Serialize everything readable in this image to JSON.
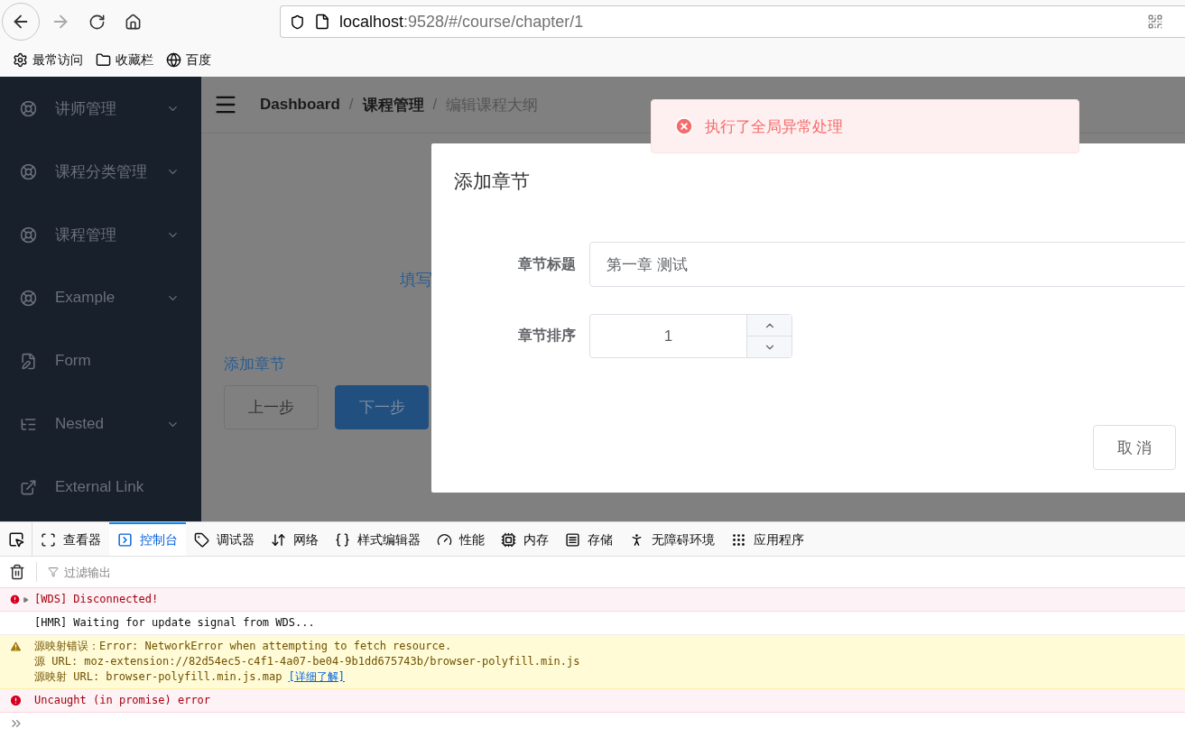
{
  "browser": {
    "address": {
      "host": "localhost",
      "path": ":9528/#/course/chapter/1"
    },
    "bookmarks": [
      {
        "label": "最常访问"
      },
      {
        "label": "收藏栏"
      },
      {
        "label": "百度"
      }
    ]
  },
  "sidebar": {
    "items": [
      {
        "label": "讲师管理",
        "expandable": true
      },
      {
        "label": "课程分类管理",
        "expandable": true
      },
      {
        "label": "课程管理",
        "expandable": true
      },
      {
        "label": "Example",
        "expandable": true
      },
      {
        "label": "Form",
        "expandable": false
      },
      {
        "label": "Nested",
        "expandable": true
      },
      {
        "label": "External Link",
        "expandable": false
      }
    ]
  },
  "breadcrumb": {
    "separator": "/",
    "items": [
      {
        "label": "Dashboard",
        "current": false
      },
      {
        "label": "课程管理",
        "current": false
      },
      {
        "label": "编辑课程大纲",
        "current": true
      }
    ]
  },
  "page": {
    "steps_text": "填写",
    "section_link": "添加章节",
    "buttons": [
      {
        "label": "上一步",
        "primary": false
      },
      {
        "label": "下一步",
        "primary": true
      }
    ]
  },
  "dialog": {
    "title": "添加章节",
    "fields": [
      {
        "label": "章节标题",
        "kind": "text",
        "value": "第一章 测试"
      },
      {
        "label": "章节排序",
        "kind": "number",
        "value": "1"
      }
    ],
    "cancel": "取 消"
  },
  "toast": {
    "kind": "error",
    "message": "执行了全局异常处理"
  },
  "devtools": {
    "tabs": [
      {
        "label": "查看器",
        "selected": false
      },
      {
        "label": "控制台",
        "selected": true
      },
      {
        "label": "调试器",
        "selected": false
      },
      {
        "label": "网络",
        "selected": false
      },
      {
        "label": "样式编辑器",
        "selected": false
      },
      {
        "label": "性能",
        "selected": false
      },
      {
        "label": "内存",
        "selected": false
      },
      {
        "label": "存储",
        "selected": false
      },
      {
        "label": "无障碍环境",
        "selected": false
      },
      {
        "label": "应用程序",
        "selected": false
      }
    ],
    "filter_placeholder": "过滤输出",
    "messages": [
      {
        "kind": "error",
        "expandable": true,
        "lines": [
          "[WDS] Disconnected!"
        ]
      },
      {
        "kind": "log",
        "expandable": false,
        "lines": [
          "[HMR] Waiting for update signal from WDS..."
        ]
      },
      {
        "kind": "warning",
        "expandable": false,
        "lines": [
          "源映射错误：Error: NetworkError when attempting to fetch resource.",
          "源 URL: moz-extension://82d54ec5-c4f1-4a07-be04-9b1dd675743b/browser-polyfill.min.js",
          "源映射 URL: browser-polyfill.min.js.map"
        ],
        "link": "[详细了解]"
      },
      {
        "kind": "error",
        "expandable": false,
        "lines": [
          "Uncaught (in promise) error"
        ]
      }
    ]
  }
}
